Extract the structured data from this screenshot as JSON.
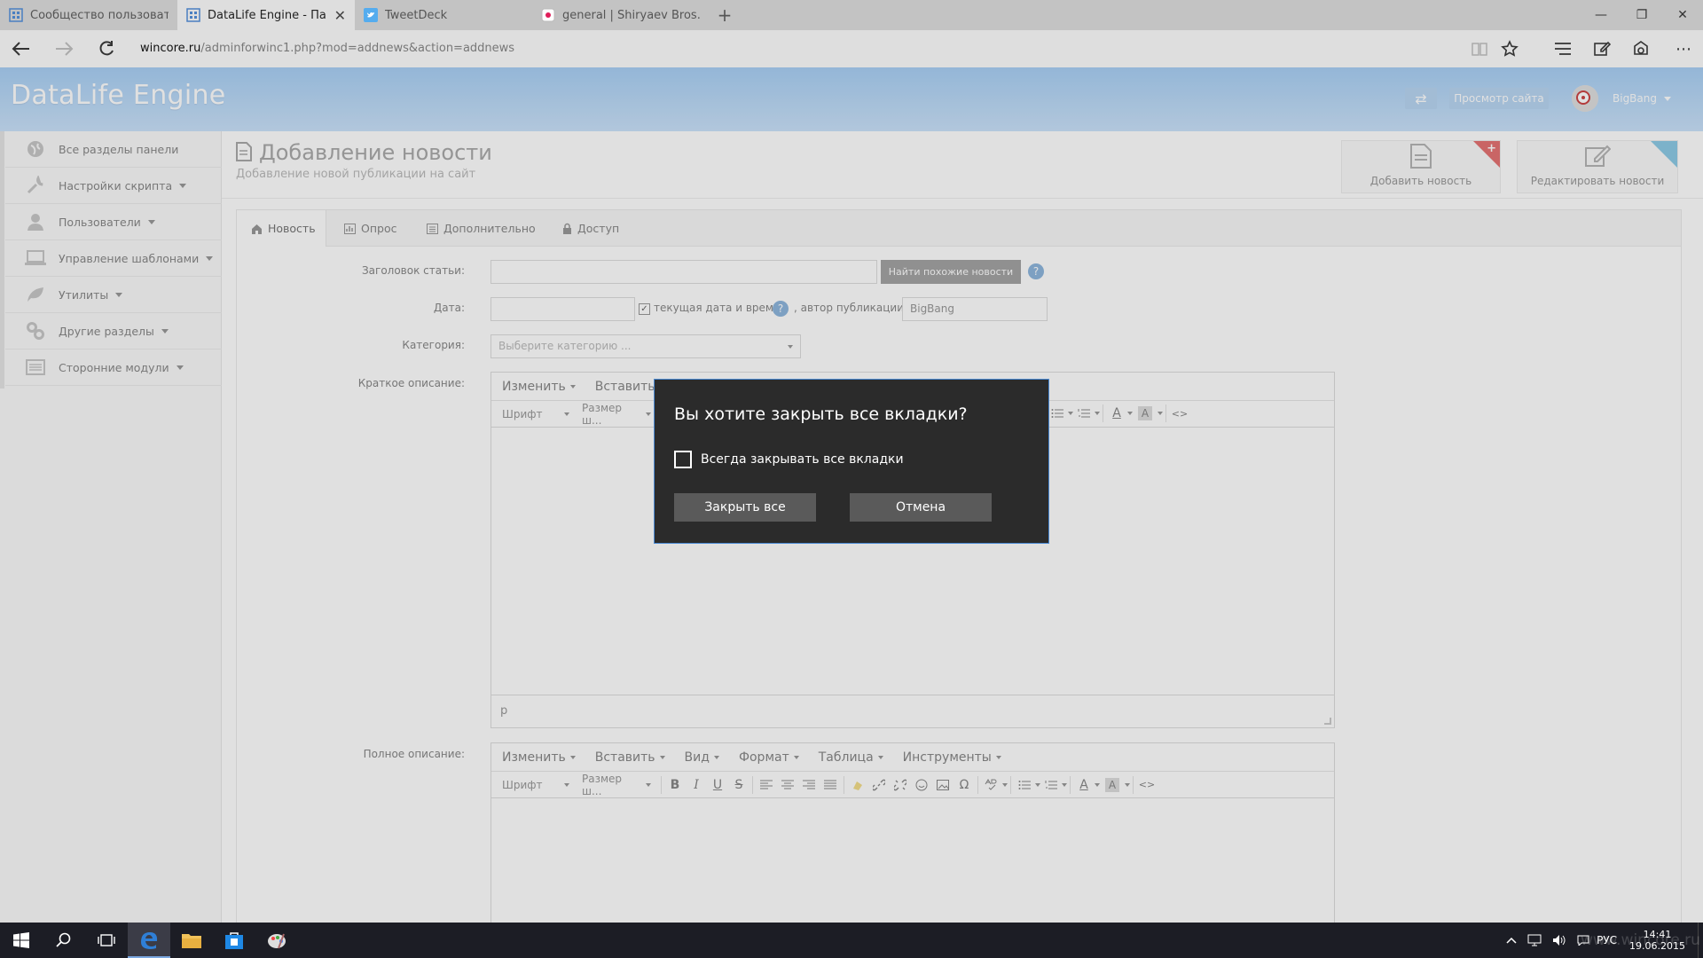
{
  "browser": {
    "tabs": [
      {
        "title": "Сообщество пользователей",
        "active": false
      },
      {
        "title": "DataLife Engine - Панель",
        "active": true
      },
      {
        "title": "TweetDeck",
        "active": false
      },
      {
        "title": "general | Shiryaev Bros. Slack",
        "active": false
      }
    ],
    "new_tab": "+",
    "url_domain": "wincore.ru",
    "url_rest": "/adminforwinc1.php?mod=addnews&action=addnews",
    "window_controls": {
      "minimize": "—",
      "restore": "❐",
      "close": "✕"
    }
  },
  "site": {
    "logo": "DataLife Engine",
    "switch_label": "⇄",
    "view_site": "Просмотр сайта",
    "username": "BigBang"
  },
  "sidebar": {
    "items": [
      {
        "label": "Все разделы панели",
        "icon": "globe-icon",
        "has_caret": false
      },
      {
        "label": "Настройки скрипта",
        "icon": "wrench-icon",
        "has_caret": true
      },
      {
        "label": "Пользователи",
        "icon": "user-icon",
        "has_caret": true
      },
      {
        "label": "Управление шаблонами",
        "icon": "laptop-icon",
        "has_caret": true
      },
      {
        "label": "Утилиты",
        "icon": "leaf-icon",
        "has_caret": true
      },
      {
        "label": "Другие разделы",
        "icon": "link-icon",
        "has_caret": true
      },
      {
        "label": "Сторонние модули",
        "icon": "list-icon",
        "has_caret": true
      }
    ]
  },
  "page": {
    "title": "Добавление новости",
    "subtitle": "Добавление новой публикации на сайт",
    "quick": {
      "add": "Добавить новость",
      "edit": "Редактировать новости"
    }
  },
  "form_tabs": [
    {
      "label": "Новость",
      "icon": "home-icon"
    },
    {
      "label": "Опрос",
      "icon": "bar-chart-icon"
    },
    {
      "label": "Дополнительно",
      "icon": "list-icon"
    },
    {
      "label": "Доступ",
      "icon": "lock-icon"
    }
  ],
  "form": {
    "title_label": "Заголовок статьи:",
    "title_value": "",
    "find_similar": "Найти похожие новости",
    "date_label": "Дата:",
    "date_value": "",
    "current_date_label": "текущая дата и время",
    "author_label": ", автор публикации:",
    "author_value": "BigBang",
    "category_label": "Категория:",
    "category_placeholder": "Выберите категорию ...",
    "short_label": "Краткое описание:",
    "full_label": "Полное описание:",
    "path_indicator": "p",
    "help": "?"
  },
  "editor": {
    "menu": [
      "Изменить",
      "Вставить",
      "Вид",
      "Формат",
      "Таблица",
      "Инструменты"
    ],
    "font_select": "Шрифт",
    "size_select": "Размер ш..."
  },
  "dialog": {
    "title": "Вы хотите закрыть все вкладки?",
    "checkbox_label": "Всегда закрывать все вкладки",
    "confirm": "Закрыть все",
    "cancel": "Отмена"
  },
  "taskbar": {
    "language": "РУС",
    "time": "14:41",
    "date": "19.06.2015",
    "watermark": "www.wincore.ru"
  }
}
